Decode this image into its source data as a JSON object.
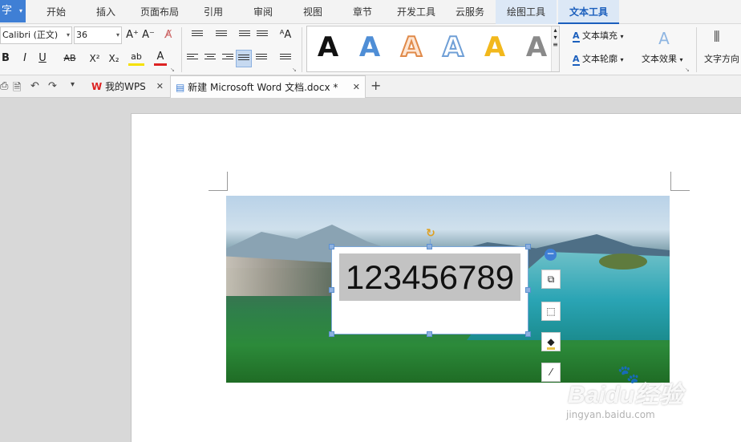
{
  "app_button": {
    "label": "字",
    "arrow": "▾"
  },
  "ribbon_tabs": [
    {
      "label": "开始"
    },
    {
      "label": "插入"
    },
    {
      "label": "页面布局"
    },
    {
      "label": "引用"
    },
    {
      "label": "审阅"
    },
    {
      "label": "视图"
    },
    {
      "label": "章节"
    },
    {
      "label": "开发工具"
    },
    {
      "label": "云服务"
    },
    {
      "label": "绘图工具"
    },
    {
      "label": "文本工具"
    }
  ],
  "toolbar": {
    "font_name": "Calibri (正文)",
    "font_size": "36",
    "grow_font": "A⁺",
    "shrink_font": "A⁻",
    "clear_format": "A̸",
    "bold": "B",
    "italic": "I",
    "underline": "U",
    "strike": "AB",
    "superscript": "X²",
    "subscript": "X₂",
    "highlight": "ab",
    "font_color": "A",
    "text_fill_label": "文本填充",
    "text_outline_label": "文本轮廓",
    "text_effect_label": "文本效果",
    "text_direction_label": "文字方向",
    "gallery_styles": [
      {
        "glyph": "A",
        "color": "#111111",
        "style": "solid"
      },
      {
        "glyph": "A",
        "color": "#4f8ed6",
        "style": "solid"
      },
      {
        "glyph": "A",
        "color": "#e08a4a",
        "style": "outline"
      },
      {
        "glyph": "A",
        "color": "#6f9fd6",
        "style": "outline"
      },
      {
        "glyph": "A",
        "color": "#f2b81c",
        "style": "solid"
      },
      {
        "glyph": "A",
        "color": "#8a8a8a",
        "style": "gradient"
      }
    ]
  },
  "doc_tabs": [
    {
      "label": "我的WPS",
      "active": false
    },
    {
      "label": "新建 Microsoft Word 文档.docx *",
      "active": true
    }
  ],
  "new_tab": "+",
  "textbox": {
    "content": "123456789"
  },
  "watermark": {
    "brand": "Baidu经验",
    "url": "jingyan.baidu.com"
  },
  "colors": {
    "accent": "#3f7fd5",
    "active_tab": "#1b5fbd",
    "context_tab_bg": "#dce8f6"
  }
}
